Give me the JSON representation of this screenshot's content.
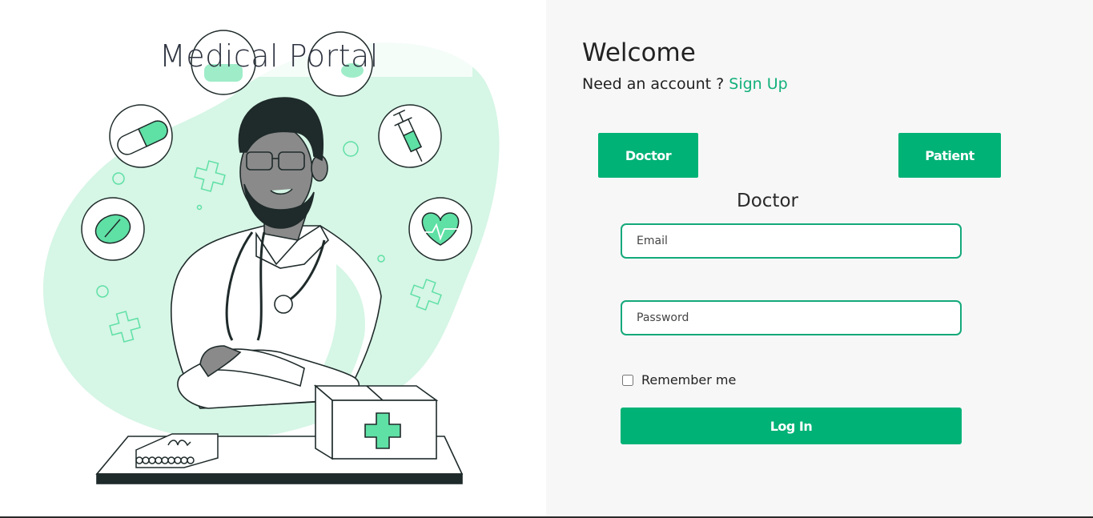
{
  "brand": {
    "title": "Medical Portal"
  },
  "auth": {
    "welcome": "Welcome",
    "signup_prompt": "Need an account ? ",
    "signup_link": "Sign Up",
    "roles": {
      "doctor_label": "Doctor",
      "patient_label": "Patient"
    },
    "selected_role_heading": "Doctor",
    "email_placeholder": "Email",
    "password_placeholder": "Password",
    "remember_label": "Remember me",
    "login_label": "Log In"
  },
  "colors": {
    "accent": "#00b276",
    "illustration_bg": "#d4f5e4",
    "illustration_mint": "#5fe0a5",
    "ink": "#1f2a2a"
  },
  "icons": [
    "capsule-icon",
    "pill-icon",
    "syringe-icon",
    "heart-pulse-icon",
    "medical-cross-icon",
    "first-aid-box-icon",
    "notebook-icon",
    "doctor-illustration"
  ]
}
